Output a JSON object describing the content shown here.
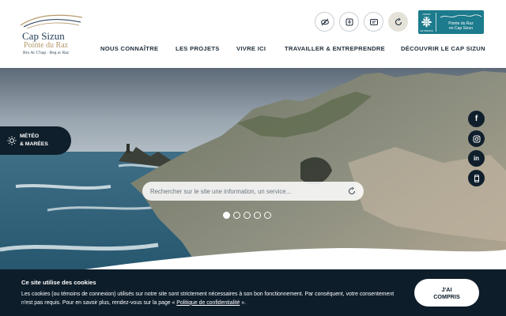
{
  "logo": {
    "title": "Cap Sizun",
    "subtitle": "Pointe du Raz",
    "tagline": "Bro Ar C'hap · Beg ar Raz"
  },
  "toolbar": [
    {
      "name": "tool-hide-icon",
      "icon": "eye-off-icon"
    },
    {
      "name": "tool-accessibility",
      "icon": "accessibility-icon"
    },
    {
      "name": "tool-translate",
      "icon": "translate-icon"
    },
    {
      "name": "tool-search",
      "icon": "search-icon"
    }
  ],
  "grand_site": {
    "badge_top": "GRAND SITE",
    "badge_bottom": "DE FRANCE",
    "name_line1": "Pointe du Raz",
    "name_line2": "en Cap Sizun"
  },
  "nav": [
    "NOUS CONNAÎTRE",
    "LES PROJETS",
    "VIVRE ICI",
    "TRAVAILLER & ENTREPRENDRE",
    "DÉCOUVRIR LE CAP SIZUN"
  ],
  "meteo": {
    "line1": "MÉTÉO",
    "line2": "& MARÉES"
  },
  "social": [
    {
      "name": "facebook-icon",
      "glyph": "f"
    },
    {
      "name": "instagram-icon",
      "glyph": ""
    },
    {
      "name": "linkedin-icon",
      "glyph": "in"
    },
    {
      "name": "mobile-icon",
      "glyph": ""
    }
  ],
  "search": {
    "placeholder": "Rechercher sur le site une information, un service..."
  },
  "slider": {
    "count": 5,
    "active": 1
  },
  "cookie": {
    "title": "Ce site utilise des cookies",
    "text_before": "Les cookies (ou témoins de connexion) utilisés sur notre site sont strictement nécessaires à son bon fonctionnement. Par conséquent, votre consentement n'est pas requis. Pour en savoir plus, rendez-vous sur la page « ",
    "link": "Politique de confidentialité",
    "text_after": " ».",
    "button_line1": "J'AI",
    "button_line2": "COMPRIS"
  },
  "colors": {
    "navy": "#101f2c",
    "teal": "#1c7b8c",
    "gold": "#b59a6a"
  }
}
